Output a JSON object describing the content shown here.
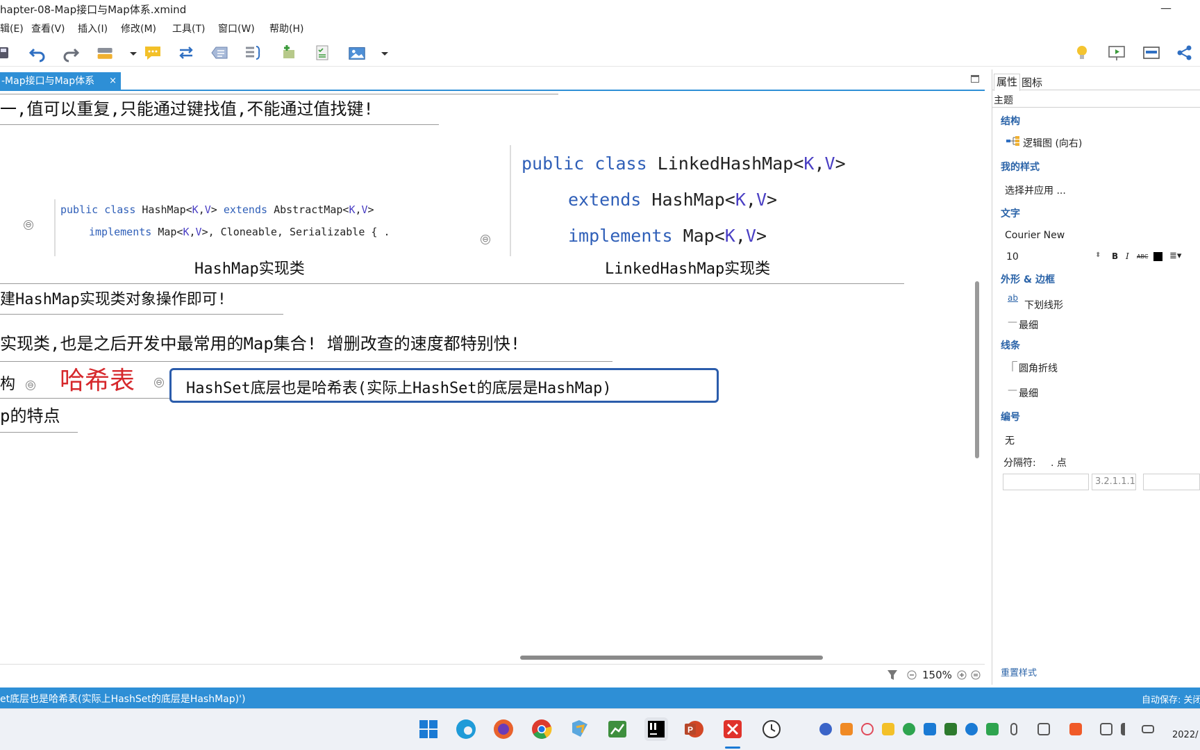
{
  "window": {
    "title": "hapter-08-Map接口与Map体系.xmind",
    "minimize": "—"
  },
  "menu": [
    "辑(E)",
    "查看(V)",
    "插入(I)",
    "修改(M)",
    "工具(T)",
    "窗口(W)",
    "帮助(H)"
  ],
  "toolbar": {
    "left_icons": [
      "save-icon",
      "undo-icon",
      "redo-icon",
      "topic-icon",
      "dropdown-icon",
      "callout-icon",
      "relationship-icon",
      "boundary-icon",
      "summary-icon",
      "insert-topic-icon",
      "task-icon",
      "image-icon",
      "dropdown-icon"
    ],
    "right_icons": [
      "lightbulb-icon",
      "presentation-icon",
      "view-icon",
      "share-icon"
    ]
  },
  "editor_tab": {
    "label": "-Map接口与Map体系",
    "close": "×"
  },
  "canvas": {
    "top_node": "一,值可以重复,只能通过键找值,不能通过值找键!",
    "hashmap_code": {
      "line1": [
        {
          "t": "public class ",
          "c": "kw"
        },
        {
          "t": "HashMap<",
          "c": ""
        },
        {
          "t": "K",
          "c": "tp"
        },
        {
          "t": ",",
          "c": ""
        },
        {
          "t": "V",
          "c": "tp"
        },
        {
          "t": "> ",
          "c": ""
        },
        {
          "t": "extends ",
          "c": "kw"
        },
        {
          "t": "AbstractMap<",
          "c": ""
        },
        {
          "t": "K",
          "c": "tp"
        },
        {
          "t": ",",
          "c": ""
        },
        {
          "t": "V",
          "c": "tp"
        },
        {
          "t": ">",
          "c": ""
        }
      ],
      "line2": [
        {
          "t": "implements ",
          "c": "kw"
        },
        {
          "t": "Map<",
          "c": ""
        },
        {
          "t": "K",
          "c": "tp"
        },
        {
          "t": ",",
          "c": ""
        },
        {
          "t": "V",
          "c": "tp"
        },
        {
          "t": ">, Cloneable, Serializable { .",
          "c": ""
        }
      ]
    },
    "hashmap_caption": "HashMap实现类",
    "linked_code": {
      "line1": [
        {
          "t": "public class ",
          "c": "kw"
        },
        {
          "t": "LinkedHashMap<",
          "c": ""
        },
        {
          "t": "K",
          "c": "tp"
        },
        {
          "t": ",",
          "c": ""
        },
        {
          "t": "V",
          "c": "tp"
        },
        {
          "t": ">",
          "c": ""
        }
      ],
      "line2": [
        {
          "t": "extends ",
          "c": "kw"
        },
        {
          "t": "HashMap<",
          "c": ""
        },
        {
          "t": "K",
          "c": "tp"
        },
        {
          "t": ",",
          "c": ""
        },
        {
          "t": "V",
          "c": "tp"
        },
        {
          "t": ">",
          "c": ""
        }
      ],
      "line3": [
        {
          "t": "implements ",
          "c": "kw"
        },
        {
          "t": "Map<",
          "c": ""
        },
        {
          "t": "K",
          "c": "tp"
        },
        {
          "t": ",",
          "c": ""
        },
        {
          "t": "V",
          "c": "tp"
        },
        {
          "t": ">",
          "c": ""
        }
      ]
    },
    "linked_caption": "LinkedHashMap实现类",
    "node_create": "建HashMap实现类对象操作即可!",
    "node_impl": "实现类,也是之后开发中最常用的Map集合! 增删改查的速度都特别快!",
    "node_struct": "构",
    "node_hash": "哈希表",
    "node_hashset": "HashSet底层也是哈希表(实际上HashSet的底层是HashMap)",
    "node_features": "p的特点",
    "collapse_symbol": "⊖"
  },
  "zoom": {
    "value": "150%"
  },
  "properties": {
    "tabs": [
      "属性",
      "图标"
    ],
    "theme_label": "主题",
    "structure_header": "结构",
    "structure_value": "逻辑图 (向右)",
    "mystyle_header": "我的样式",
    "mystyle_value": "选择并应用 ...",
    "text_header": "文字",
    "font_name": "Courier New",
    "font_size": "10",
    "shape_header": "外形 & 边框",
    "shape_value": "下划线形",
    "shape_weight": "最细",
    "line_header": "线条",
    "line_value": "圆角折线",
    "line_weight": "最细",
    "numbering_header": "编号",
    "numbering_value": "无",
    "separator_label": "分隔符:",
    "separator_value": ". 点",
    "numbering_format": "3.2.1.1.1",
    "reset_style": "重置样式"
  },
  "status": {
    "text": "et底层也是哈希表(实际上HashSet的底层是HashMap)')",
    "autosave": "自动保存: 关闭"
  },
  "taskbar": {
    "apps": [
      "start-icon",
      "edge-icon",
      "firefox-icon",
      "chrome-icon",
      "explorer-icon",
      "chart-app-icon",
      "intellij-icon",
      "powerpoint-icon",
      "xmind-icon",
      "clock-app-icon"
    ],
    "clock": "2022/"
  },
  "colors": {
    "accent": "#2e8fd6",
    "keyword": "#2f5fb8",
    "type_param": "#4a3fc4",
    "hash_red": "#d6282c",
    "selection_border": "#2b5cab",
    "panel_header": "#2a63a8"
  }
}
